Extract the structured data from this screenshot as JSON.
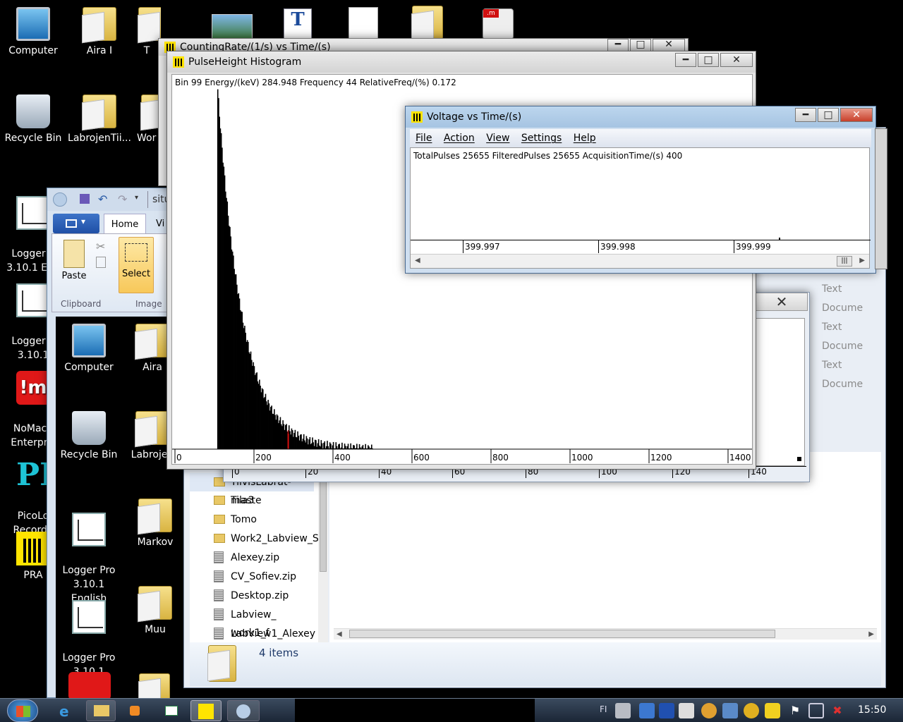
{
  "desktop": {
    "icons": [
      {
        "label": "Computer"
      },
      {
        "label": "Aira I"
      },
      {
        "label": "Recycle Bin"
      },
      {
        "label": "LabrojenTii..."
      },
      {
        "label": "Logger P\n3.10.1 Eng"
      },
      {
        "label": "Logger P\n3.10.1"
      },
      {
        "label": "NoMach\nEnterpris"
      },
      {
        "label": "PicoLo\nRecorde"
      },
      {
        "label": "PRA"
      },
      {
        "label": "T"
      },
      {
        "label": "Wor"
      }
    ]
  },
  "counting_window": {
    "title": "CountingRate/(1/s) vs Time/(s)"
  },
  "histogram_window": {
    "title": "PulseHeight Histogram",
    "info": "Bin 99  Energy/(keV) 284.948  Frequency 44  RelativeFreq/(%) 0.172",
    "ticks": [
      "0",
      "200",
      "400",
      "600",
      "800",
      "1000",
      "1200",
      "1400"
    ]
  },
  "voltage_window": {
    "title": "Voltage vs Time/(s)",
    "menu": [
      "File",
      "Action",
      "View",
      "Settings",
      "Help"
    ],
    "stats": "TotalPulses 25655  FilteredPulses 25655  AcquisitionTime/(s) 400",
    "ticks": [
      "399.997",
      "399.998",
      "399.999"
    ]
  },
  "back_plot": {
    "ticks": [
      "0",
      "20",
      "40",
      "60",
      "80",
      "100",
      "120",
      "140"
    ]
  },
  "paint": {
    "tab_home": "Home",
    "tab_view": "Vi",
    "title_partial": "situ",
    "paste": "Paste",
    "select": "Select",
    "group_clipboard": "Clipboard",
    "group_image": "Image"
  },
  "paint_desktop": {
    "icons": [
      "Computer",
      "Aira",
      "Recycle Bin",
      "Labrojen",
      "Logger Pro\n3.10.1 English",
      "Markov",
      "Logger Pro\n3.10.1",
      "Muu"
    ]
  },
  "explorer": {
    "items": [
      {
        "name": "TiivisLabrat-maste",
        "kind": "folder"
      },
      {
        "name": "Tila3",
        "kind": "folder"
      },
      {
        "name": "Tomo",
        "kind": "folder"
      },
      {
        "name": "Work2_Labview_S",
        "kind": "folder"
      },
      {
        "name": "Alexey.zip",
        "kind": "zip"
      },
      {
        "name": "CV_Sofiev.zip",
        "kind": "zip"
      },
      {
        "name": "Desktop.zip",
        "kind": "zip"
      },
      {
        "name": "Labview_ work1_f",
        "kind": "zip"
      },
      {
        "name": "Labview1_Alexey",
        "kind": "zip"
      }
    ],
    "status": "4 items",
    "right_types": [
      "Text Docume",
      "Text Docume",
      "Text Docume"
    ]
  },
  "taskbar": {
    "lang": "FI",
    "clock": "15:50"
  },
  "colors": {
    "histogram_marker": "#d01010",
    "pra_yellow": "#ffe400"
  }
}
